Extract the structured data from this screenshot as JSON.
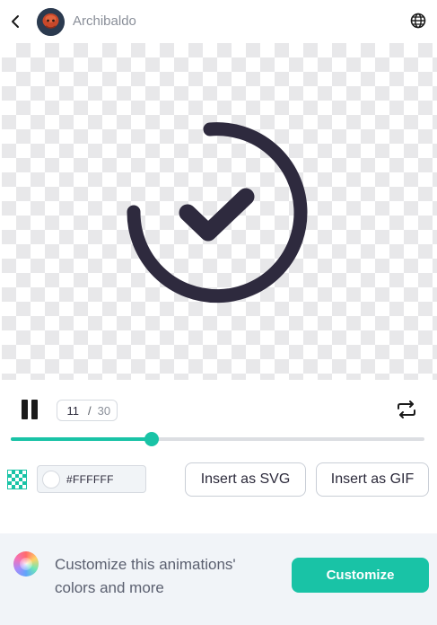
{
  "header": {
    "back_icon": "chevron-left-icon",
    "username": "Archibaldo",
    "avatar_color": "#c8482a",
    "globe_icon": "globe-icon"
  },
  "preview": {
    "background": "transparent-checkerboard",
    "animation_icon": "check-circle-icon",
    "stroke_color": "#2e2a3e"
  },
  "playback": {
    "pause_icon": "pause-icon",
    "current_frame": "11",
    "separator": "/",
    "total_frames": "30",
    "progress_fraction": 0.34,
    "loop_icon": "repeat-icon"
  },
  "color": {
    "transparent_toggle_icon": "checkerboard-icon",
    "swatch_color": "#FFFFFF",
    "hex_value": "#FFFFFF"
  },
  "actions": {
    "insert_svg_label": "Insert as SVG",
    "insert_gif_label": "Insert as GIF"
  },
  "footer": {
    "wheel_icon": "color-wheel-icon",
    "text": "Customize this animations' colors and more",
    "customize_label": "Customize"
  },
  "colors": {
    "accent": "#19C3A6",
    "text_dark": "#2C2A3B",
    "muted": "#8A8F99",
    "footer_bg": "#F1F4F8"
  }
}
